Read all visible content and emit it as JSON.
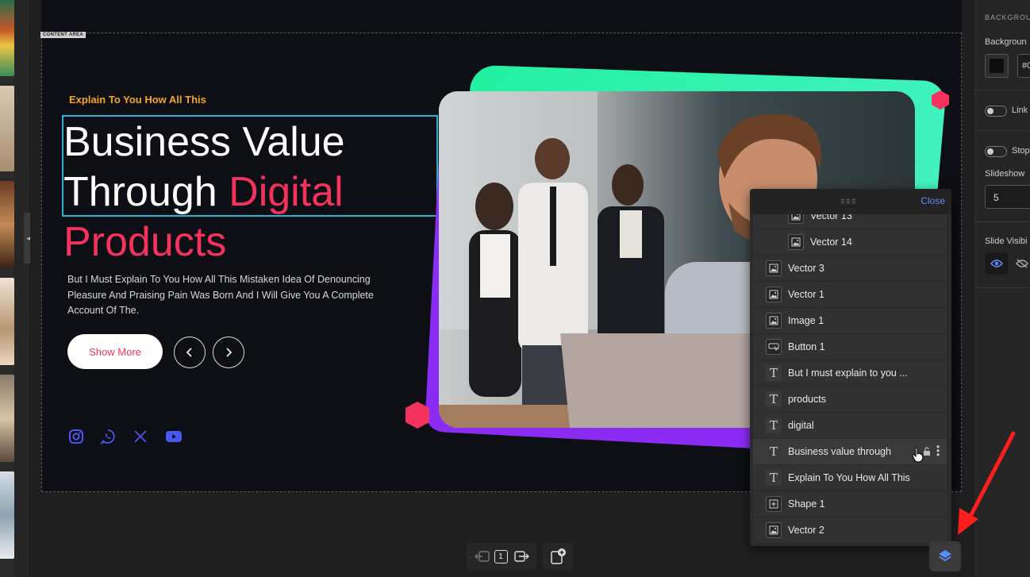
{
  "canvas": {
    "content_area_label": "CONTENT AREA"
  },
  "slide": {
    "subtitle": "Explain To You How All This",
    "heading_line1": "Business Value",
    "heading_line2a": "Through ",
    "heading_line2b": "Digital",
    "heading_line3": "Products",
    "paragraph": "But I Must Explain To You How All This Mistaken Idea Of Denouncing Pleasure And Praising Pain Was Born And I Will Give You A Complete Account Of The.",
    "cta_label": "Show More",
    "accent_color": "#f4325e",
    "subtitle_color": "#f5a623",
    "social_icons": [
      "instagram-icon",
      "whatsapp-icon",
      "x-icon",
      "youtube-icon"
    ]
  },
  "right_panel": {
    "section_title": "BACKGROU",
    "background_label": "Backgroun",
    "color_value": "#0",
    "link_label": "Link",
    "stop_label": "Stop",
    "slideshow_label": "Slideshow",
    "slideshow_value": "5",
    "slide_visibility_label": "Slide Visibi"
  },
  "bottom_toolbar": {
    "page_number": "1"
  },
  "layers": {
    "close_label": "Close",
    "items": [
      {
        "label": "Vector 13",
        "icon": "image-icon",
        "child": true
      },
      {
        "label": "Vector 14",
        "icon": "image-icon",
        "child": true
      },
      {
        "label": "Vector 3",
        "icon": "image-icon",
        "child": false
      },
      {
        "label": "Vector 1",
        "icon": "image-icon",
        "child": false
      },
      {
        "label": "Image 1",
        "icon": "image-icon",
        "child": false
      },
      {
        "label": "Button 1",
        "icon": "button-icon",
        "child": false
      },
      {
        "label": "But I must explain to you ...",
        "icon": "text-icon",
        "child": false
      },
      {
        "label": "products",
        "icon": "text-icon",
        "child": false
      },
      {
        "label": "digital",
        "icon": "text-icon",
        "child": false
      },
      {
        "label": "Business value through",
        "icon": "text-icon",
        "child": false,
        "active": true
      },
      {
        "label": "Explain To You How All This",
        "icon": "text-icon",
        "child": false
      },
      {
        "label": "Shape 1",
        "icon": "shape-icon",
        "child": false
      },
      {
        "label": "Vector 2",
        "icon": "image-icon",
        "child": false
      }
    ]
  }
}
